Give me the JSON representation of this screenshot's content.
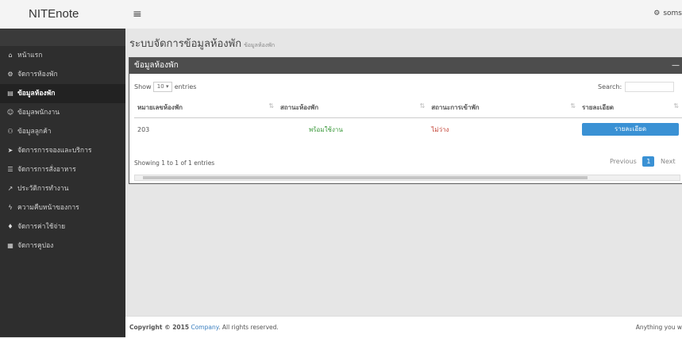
{
  "app": {
    "brand": "NITEnote",
    "user": "soms"
  },
  "sidebar": {
    "items": [
      {
        "icon": "home-icon",
        "glyph": "⌂",
        "label": "หน้าแรก"
      },
      {
        "icon": "gear-icon",
        "glyph": "⚙",
        "label": "จัดการห้องพัก"
      },
      {
        "icon": "document-icon",
        "glyph": "▤",
        "label": "ข้อมูลห้องพัก"
      },
      {
        "icon": "user-icon",
        "glyph": "☺",
        "label": "ข้อมูลพนักงาน"
      },
      {
        "icon": "users-icon",
        "glyph": "⚇",
        "label": "ข้อมูลลูกค้า"
      },
      {
        "icon": "send-icon",
        "glyph": "➤",
        "label": "จัดการการจองและบริการ"
      },
      {
        "icon": "list-icon",
        "glyph": "☰",
        "label": "จัดการการสั่งอาหาร"
      },
      {
        "icon": "chart-icon",
        "glyph": "↗",
        "label": "ประวัติการทำงาน"
      },
      {
        "icon": "bolt-icon",
        "glyph": "ϟ",
        "label": "ความคืบหน้าของการ"
      },
      {
        "icon": "tag-icon",
        "glyph": "♦",
        "label": "จัดการค่าใช้จ่าย"
      },
      {
        "icon": "table-icon",
        "glyph": "▦",
        "label": "จัดการคูปอง"
      }
    ]
  },
  "page": {
    "title": "ระบบจัดการข้อมูลห้องพัก",
    "subtitle": "ข้อมูลห้องพัก"
  },
  "panel": {
    "title": "ข้อมูลห้องพัก"
  },
  "table": {
    "show_label": "Show",
    "show_value": "10",
    "entries_label": "entries",
    "search_label": "Search:",
    "headers": [
      "หมายเลขห้องพัก",
      "สถานะห้องพัก",
      "สถานะการเข้าพัก",
      "รายละเอียด"
    ],
    "rows": [
      {
        "room": "203",
        "status": "พร้อมใช้งาน",
        "stay": "ไม่ว่าง",
        "detail": "รายละเอียด"
      }
    ],
    "info": "Showing 1 to 1 of 1 entries",
    "prev": "Previous",
    "page": "1",
    "next": "Next"
  },
  "footer": {
    "copyright": "Copyright © 2015",
    "company": "Company",
    "rights": ". All rights reserved.",
    "right_text": "Anything you w"
  }
}
